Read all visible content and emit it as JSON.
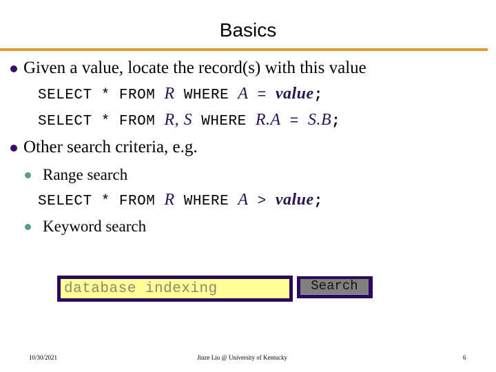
{
  "slide": {
    "title": "Basics",
    "accent_color": "#e0992a",
    "bullets": [
      {
        "text": "Given a value, locate the record(s) with this value",
        "code_lines": [
          {
            "parts": [
              "SELECT * FROM ",
              "R",
              " WHERE ",
              "A",
              " = ",
              "value",
              ";"
            ]
          },
          {
            "parts": [
              "SELECT * FROM ",
              "R, S",
              " WHERE ",
              "R.A",
              " = ",
              "S.B",
              ";"
            ]
          }
        ]
      },
      {
        "text": "Other search criteria, e.g.",
        "sub_bullets": [
          {
            "text": "Range search",
            "code": {
              "parts": [
                "SELECT * FROM ",
                "R",
                " WHERE ",
                "A",
                " > ",
                "value",
                ";"
              ]
            }
          },
          {
            "text": "Keyword search"
          }
        ]
      }
    ],
    "search": {
      "input_value": "database indexing",
      "button_label": "Search"
    },
    "footer": {
      "date": "10/30/2021",
      "author": "Jinze Liu @ University of Kentucky",
      "page_number": "6"
    }
  }
}
